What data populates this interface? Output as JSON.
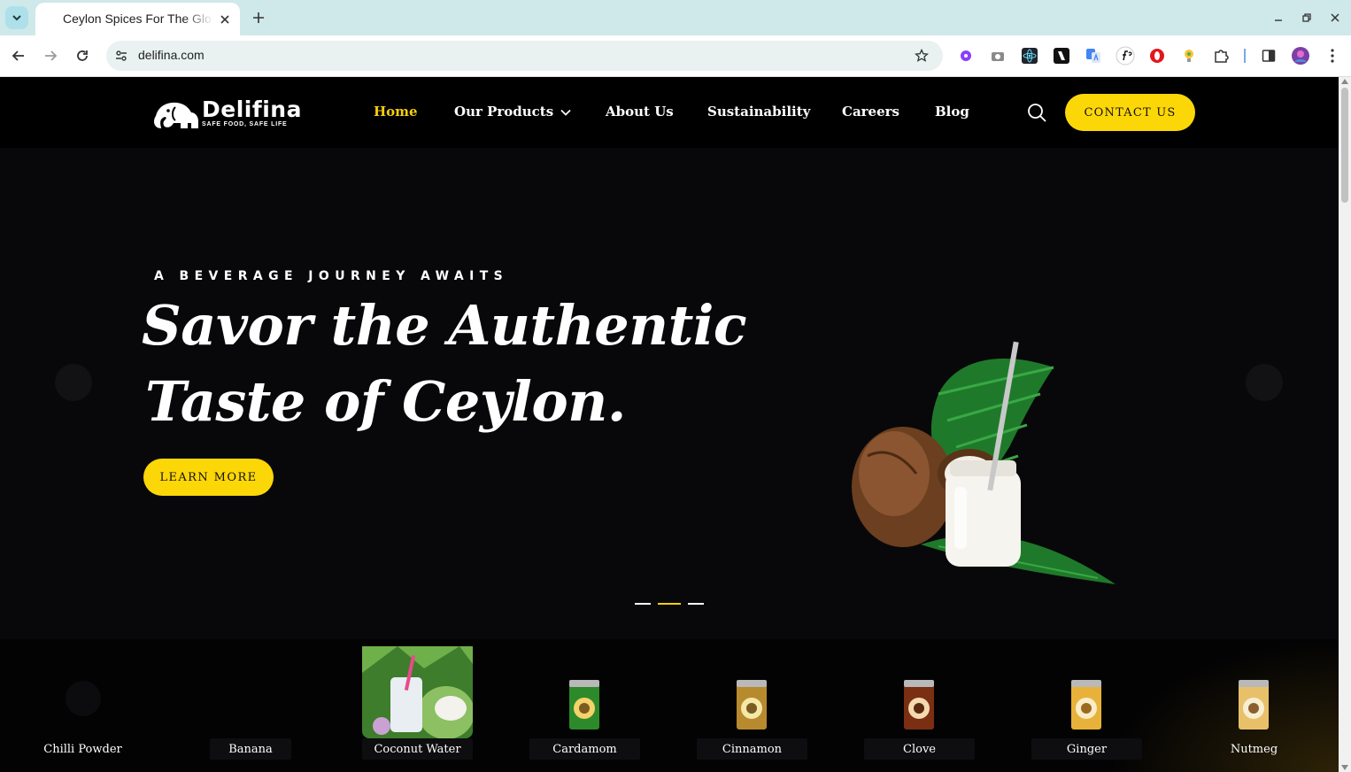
{
  "browser": {
    "tab_title": "Ceylon Spices For The Global",
    "url": "delifina.com"
  },
  "header": {
    "logo_word": "Delifina",
    "logo_tagline": "SAFE FOOD, SAFE LIFE",
    "nav": [
      {
        "label": "Home",
        "active": true
      },
      {
        "label": "Our Products",
        "has_dropdown": true
      },
      {
        "label": "About Us"
      },
      {
        "label": "Sustainability"
      },
      {
        "label": "Careers"
      },
      {
        "label": "Blog"
      }
    ],
    "contact_label": "CONTACT US"
  },
  "hero": {
    "eyebrow": "A BEVERAGE JOURNEY AWAITS",
    "headline_line1": "Savor the Authentic",
    "headline_line2": "Taste of Ceylon.",
    "cta_label": "LEARN MORE",
    "slide_count": 3,
    "active_slide": 2
  },
  "products": [
    {
      "name": "Chilli Powder"
    },
    {
      "name": "Banana"
    },
    {
      "name": "Coconut Water"
    },
    {
      "name": "Cardamom"
    },
    {
      "name": "Cinnamon"
    },
    {
      "name": "Clove"
    },
    {
      "name": "Ginger"
    },
    {
      "name": "Nutmeg"
    }
  ],
  "colors": {
    "accent": "#fcd707",
    "background": "#08080a",
    "header": "#000000"
  }
}
